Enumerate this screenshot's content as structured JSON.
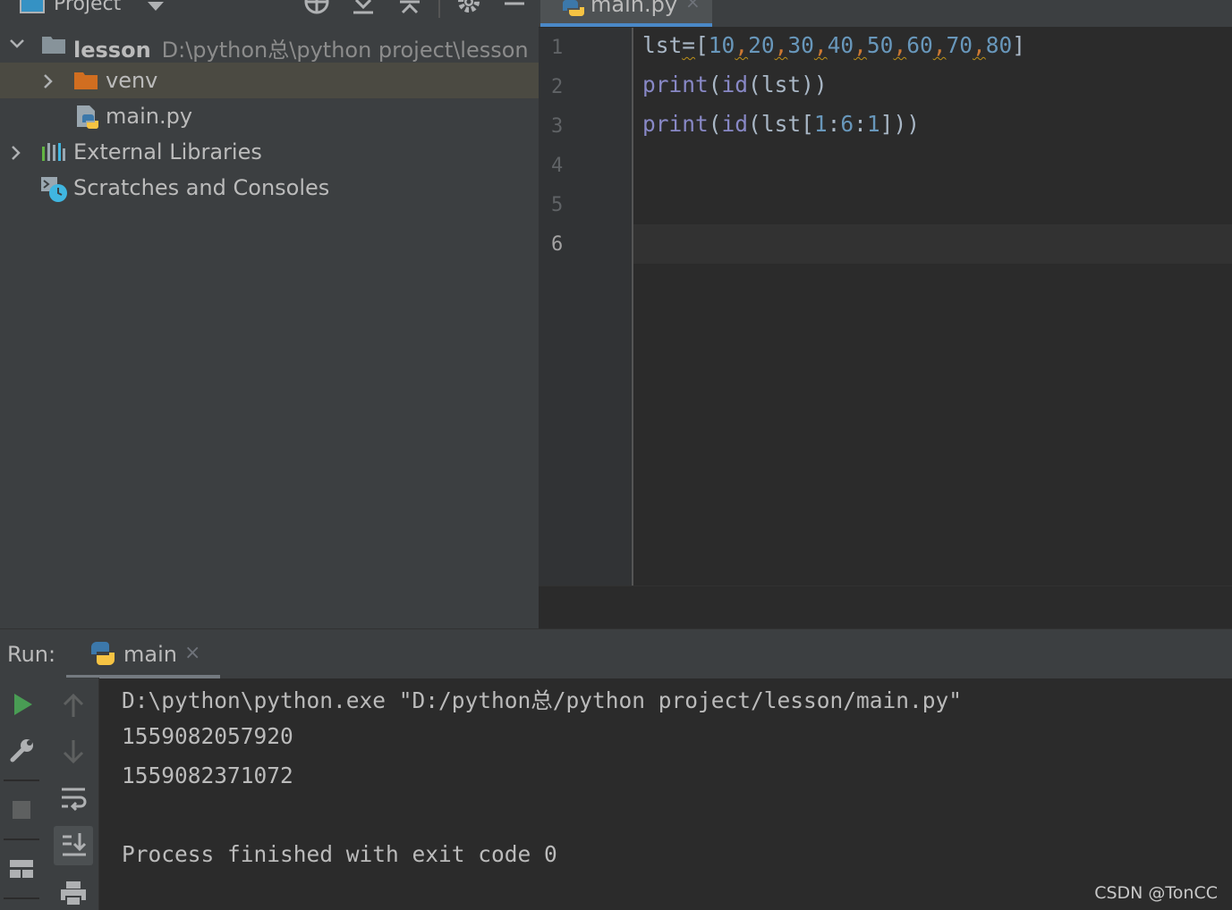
{
  "project": {
    "title": "Project",
    "tree": [
      {
        "label": "lesson",
        "path": "D:\\python总\\python project\\lesson"
      },
      {
        "label": "venv"
      },
      {
        "label": "main.py"
      },
      {
        "label": "External Libraries"
      },
      {
        "label": "Scratches and Consoles"
      }
    ]
  },
  "editor": {
    "tab_label": "main.py",
    "tab_close": "×",
    "line_numbers": [
      "1",
      "2",
      "3",
      "4",
      "5",
      "6"
    ],
    "code": {
      "l1_var": "lst",
      "l1_eq": "=",
      "l1_open": "[",
      "l1_nums": [
        "10",
        "20",
        "30",
        "40",
        "50",
        "60",
        "70",
        "80"
      ],
      "comma": ",",
      "l1_close": "]",
      "print": "print",
      "id": "id",
      "lparen": "(",
      "rparen": ")",
      "lst": "lst",
      "l3_open": "[",
      "l3_a": "1",
      "colon": ":",
      "l3_b": "6",
      "l3_c": "1",
      "l3_close": "]"
    }
  },
  "run": {
    "label": "Run:",
    "tab_label": "main",
    "tab_close": "×",
    "console": [
      "D:\\python\\python.exe \"D:/python总/python project/lesson/main.py\"",
      "1559082057920",
      "1559082371072",
      "",
      "Process finished with exit code 0"
    ]
  },
  "watermark": "CSDN @TonCC",
  "colors": {
    "panel_bg": "#3c3f41",
    "editor_bg": "#2b2b2b",
    "keyword": "#8888c6",
    "number": "#6897bb",
    "comma": "#cc7832",
    "tab_accent": "#4a88c7",
    "run_green": "#499c54"
  },
  "icons": [
    "project-icon",
    "dropdown-icon",
    "locate-icon",
    "expand-all-icon",
    "collapse-all-icon",
    "gear-icon",
    "minimize-icon",
    "folder-icon",
    "python-file-icon",
    "libraries-icon",
    "scratches-icon",
    "run-icon",
    "wrench-icon",
    "stop-icon",
    "layout-icon",
    "arrow-up-icon",
    "arrow-down-icon",
    "soft-wrap-icon",
    "scroll-to-end-icon",
    "print-icon"
  ]
}
